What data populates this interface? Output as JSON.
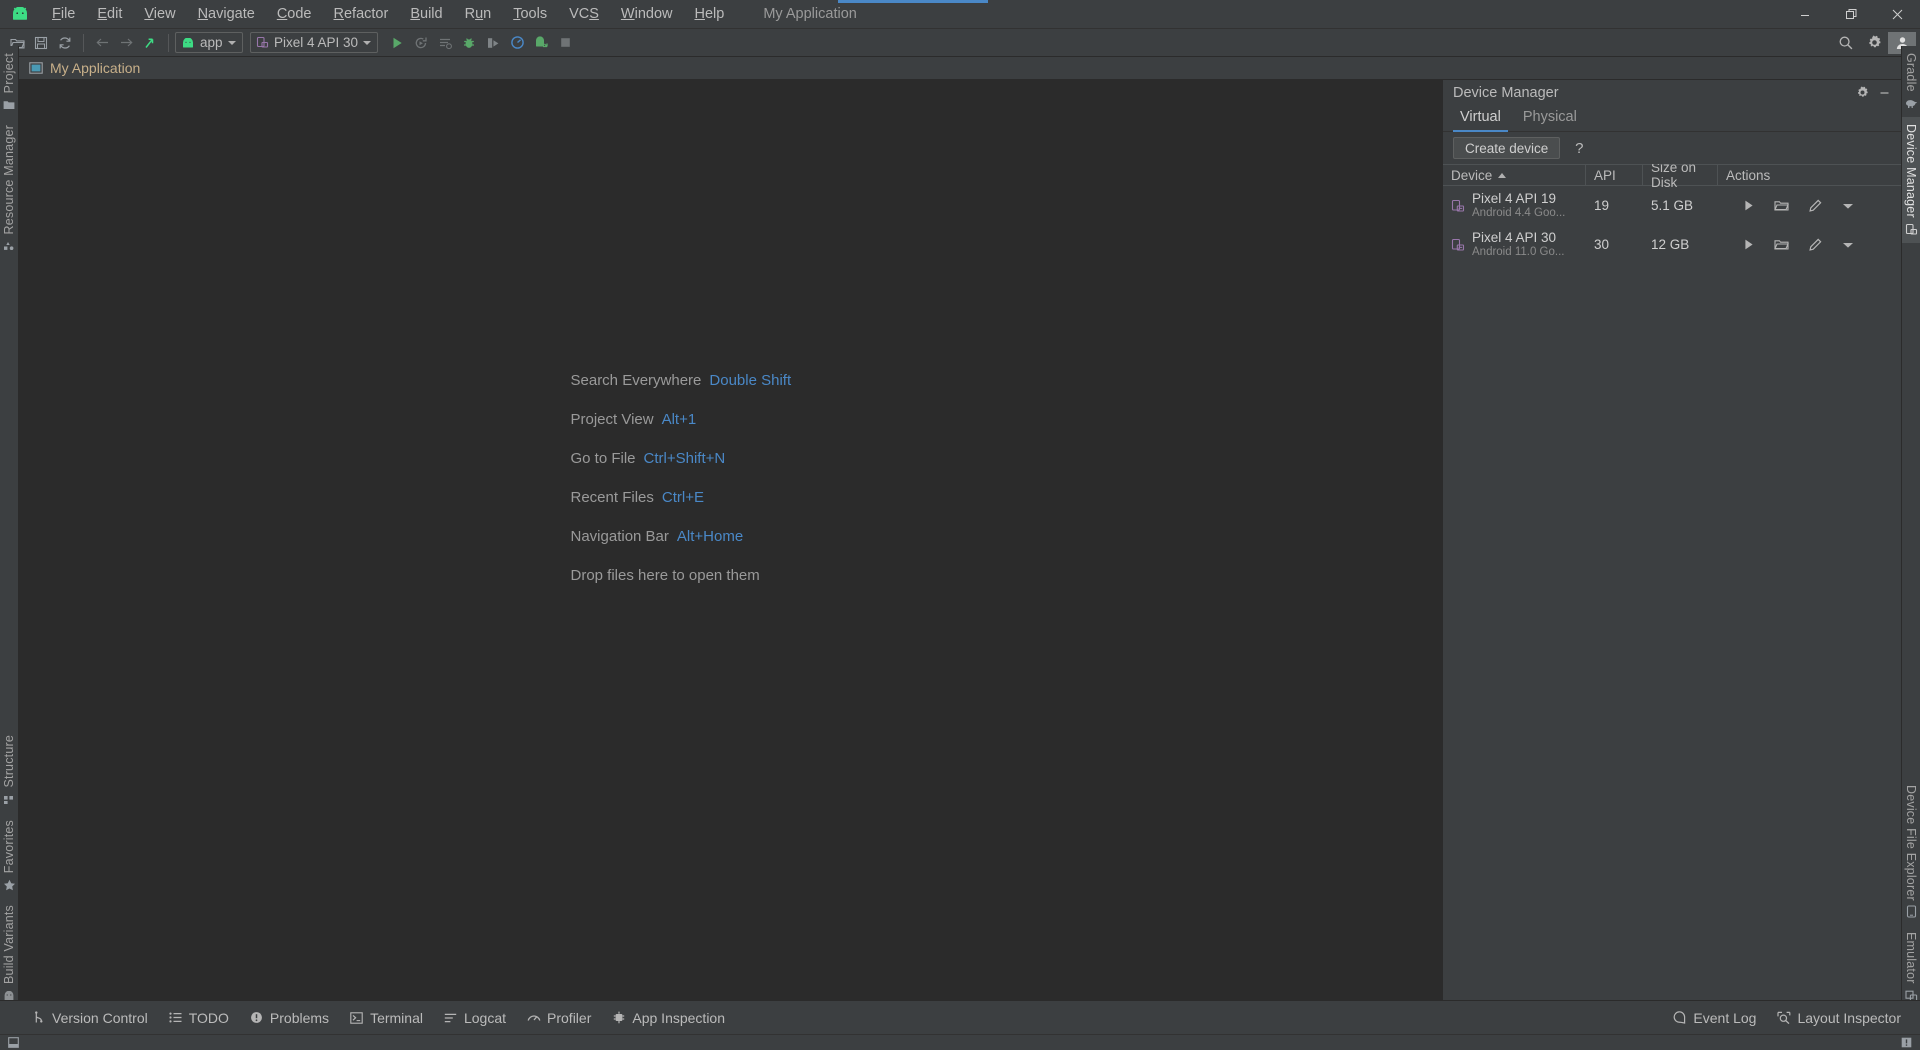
{
  "window": {
    "title": "My Application",
    "controls": [
      {
        "name": "minimize-button",
        "icon": "minimize-icon"
      },
      {
        "name": "maximize-button",
        "icon": "maximize-icon"
      },
      {
        "name": "close-button",
        "icon": "close-icon"
      }
    ]
  },
  "menubar": {
    "logo_icon": "android-logo-icon",
    "items": [
      {
        "label": "File",
        "mnemonic": "F"
      },
      {
        "label": "Edit",
        "mnemonic": "E"
      },
      {
        "label": "View",
        "mnemonic": "V"
      },
      {
        "label": "Navigate",
        "mnemonic": "N"
      },
      {
        "label": "Code",
        "mnemonic": "C"
      },
      {
        "label": "Refactor",
        "mnemonic": "R"
      },
      {
        "label": "Build",
        "mnemonic": "B"
      },
      {
        "label": "Run",
        "mnemonic": "u"
      },
      {
        "label": "Tools",
        "mnemonic": "T"
      },
      {
        "label": "VCS",
        "mnemonic": "S"
      },
      {
        "label": "Window",
        "mnemonic": "W"
      },
      {
        "label": "Help",
        "mnemonic": "H"
      }
    ]
  },
  "toolbar": {
    "left_icons": [
      "open-folder-icon",
      "save-all-icon",
      "sync-project-icon"
    ],
    "nav_icons": [
      "navigate-back-icon",
      "navigate-forward-icon",
      "jump-to-source-icon"
    ],
    "module_selector": {
      "label": "app",
      "icon": "android-module-icon"
    },
    "device_selector": {
      "label": "Pixel 4 API 30",
      "icon": "device-icon"
    },
    "run_icons": [
      "run-icon",
      "apply-changes-icon",
      "apply-code-changes-icon",
      "debug-icon",
      "attach-debugger-icon",
      "profiler-icon",
      "profile-app-icon",
      "stop-icon"
    ],
    "right_icons": [
      "search-icon",
      "settings-gear-icon",
      "user-avatar-icon"
    ]
  },
  "project_tab": {
    "label": "My Application",
    "icon": "project-window-icon"
  },
  "left_rail": {
    "items": [
      {
        "label": "Project",
        "icon": "project-folder-icon",
        "active": false
      },
      {
        "label": "Resource Manager",
        "icon": "resource-manager-icon",
        "active": false
      }
    ],
    "bottom_items": [
      {
        "label": "Structure",
        "icon": "structure-icon",
        "active": false
      },
      {
        "label": "Favorites",
        "icon": "star-icon",
        "active": false
      },
      {
        "label": "Build Variants",
        "icon": "build-variants-icon",
        "active": false
      }
    ]
  },
  "right_rail": {
    "items": [
      {
        "label": "Gradle",
        "icon": "gradle-elephant-icon",
        "active": false
      },
      {
        "label": "Device Manager",
        "icon": "device-manager-icon",
        "active": true
      }
    ],
    "bottom_items": [
      {
        "label": "Device File Explorer",
        "icon": "device-file-explorer-icon",
        "active": false
      },
      {
        "label": "Emulator",
        "icon": "emulator-icon",
        "active": false
      }
    ]
  },
  "editor": {
    "hints": [
      {
        "label": "Search Everywhere",
        "shortcut": "Double Shift"
      },
      {
        "label": "Project View",
        "shortcut": "Alt+1"
      },
      {
        "label": "Go to File",
        "shortcut": "Ctrl+Shift+N"
      },
      {
        "label": "Recent Files",
        "shortcut": "Ctrl+E"
      },
      {
        "label": "Navigation Bar",
        "shortcut": "Alt+Home"
      }
    ],
    "drop_hint": "Drop files here to open them"
  },
  "device_manager": {
    "title": "Device Manager",
    "header_icons": [
      "settings-gear-icon",
      "hide-panel-icon"
    ],
    "tabs": [
      {
        "label": "Virtual",
        "active": true
      },
      {
        "label": "Physical",
        "active": false
      }
    ],
    "create_button": "Create device",
    "help_button": "?",
    "columns": [
      {
        "label": "Device",
        "sorted": "asc"
      },
      {
        "label": "API",
        "sorted": ""
      },
      {
        "label": "Size on Disk",
        "sorted": ""
      },
      {
        "label": "Actions",
        "sorted": ""
      }
    ],
    "rows": [
      {
        "name": "Pixel 4 API 19",
        "subtitle": "Android 4.4 Goo...",
        "api": "19",
        "size_on_disk": "5.1 GB",
        "icon": "virtual-device-icon",
        "actions": [
          "run-device-icon",
          "open-folder-icon",
          "edit-pencil-icon",
          "menu-dropdown-icon"
        ]
      },
      {
        "name": "Pixel 4 API 30",
        "subtitle": "Android 11.0 Go...",
        "api": "30",
        "size_on_disk": "12 GB",
        "icon": "virtual-device-icon",
        "actions": [
          "run-device-icon",
          "open-folder-icon",
          "edit-pencil-icon",
          "menu-dropdown-icon"
        ]
      }
    ]
  },
  "statusbar": {
    "left_items": [
      {
        "label": "Version Control",
        "icon": "branch-icon"
      },
      {
        "label": "TODO",
        "icon": "todo-list-icon"
      },
      {
        "label": "Problems",
        "icon": "problems-icon"
      },
      {
        "label": "Terminal",
        "icon": "terminal-icon"
      },
      {
        "label": "Logcat",
        "icon": "logcat-icon"
      },
      {
        "label": "Profiler",
        "icon": "profiler-gauge-icon"
      },
      {
        "label": "App Inspection",
        "icon": "app-inspection-icon"
      }
    ],
    "right_items": [
      {
        "label": "Event Log",
        "icon": "event-log-icon"
      },
      {
        "label": "Layout Inspector",
        "icon": "layout-inspector-icon"
      }
    ]
  },
  "bottombar": {
    "left_icon": "toggle-toolwindows-icon",
    "right_icon": "notification-icon"
  },
  "colors": {
    "accent": "#4a88c7",
    "panel_bg": "#3c3f41",
    "editor_bg": "#2b2b2b",
    "text": "#bbbbbb",
    "android_green": "#3ddc84",
    "device_purple": "#9876aa"
  }
}
